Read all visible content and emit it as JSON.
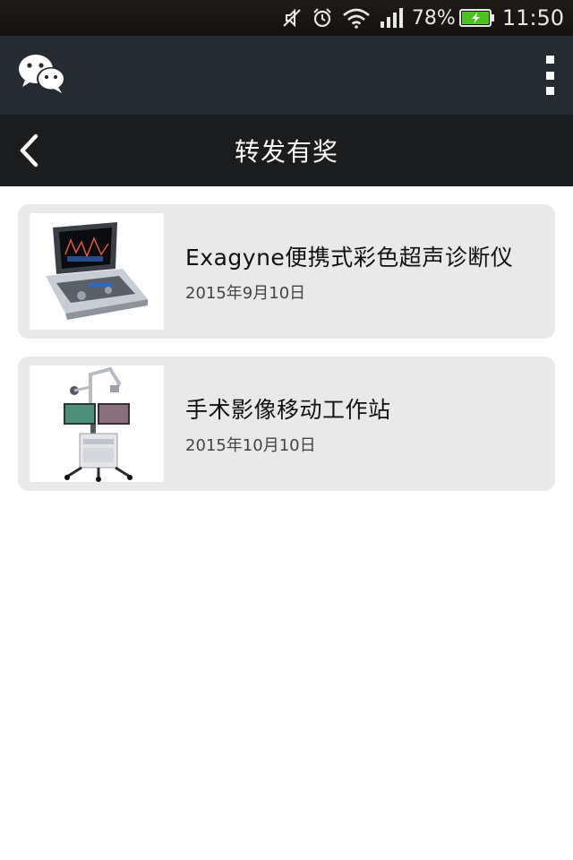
{
  "status_bar": {
    "battery_percent": "78%",
    "time": "11:50",
    "icons": [
      "mute-icon",
      "alarm-icon",
      "wifi-icon",
      "signal-icon",
      "battery-charging-icon"
    ]
  },
  "header": {
    "app_icon": "wechat-icon",
    "menu_icon": "more-vertical-icon"
  },
  "title_bar": {
    "back_icon": "chevron-left-icon",
    "title": "转发有奖"
  },
  "items": [
    {
      "title": "Exagyne便携式彩色超声诊断仪",
      "date": "2015年9月10日",
      "image": "ultrasound-device-image"
    },
    {
      "title": "手术影像移动工作站",
      "date": "2015年10月10日",
      "image": "surgical-workstation-image"
    }
  ],
  "colors": {
    "status_bar_bg": "#1a1613",
    "header_bg": "#252b30",
    "title_bar_bg": "#1b1c1d",
    "card_bg": "#e9e9e9"
  }
}
